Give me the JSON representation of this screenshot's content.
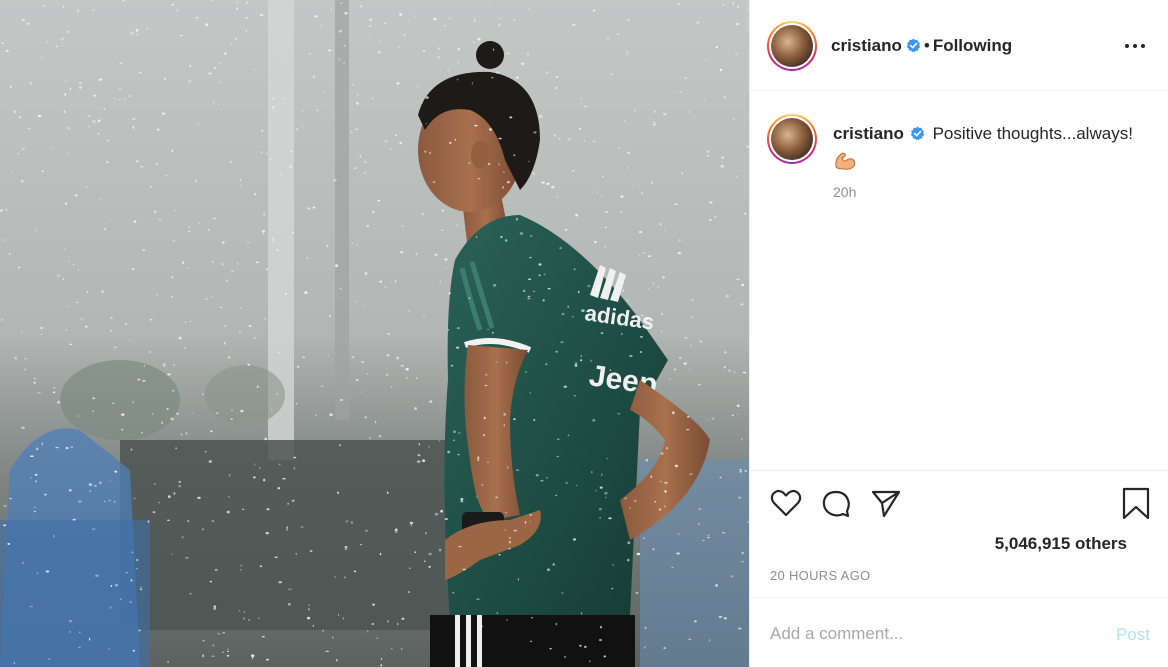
{
  "post": {
    "username": "cristiano",
    "follow_separator": "•",
    "follow_state": "Following",
    "caption": "Positive thoughts...always!",
    "caption_emoji": "flexed-biceps",
    "relative_time": "20h",
    "likes_text": "5,046,915 others",
    "posted_time": "20 HOURS AGO"
  },
  "comment": {
    "placeholder": "Add a comment...",
    "post_label": "Post"
  },
  "photo": {
    "jersey_brand": "adidas",
    "jersey_sponsor": "Jeep"
  },
  "icons": {
    "more": "more-options-icon",
    "verified": "verified-badge-icon",
    "like": "heart-icon",
    "comment": "comment-bubble-icon",
    "share": "paper-plane-icon",
    "save": "bookmark-icon"
  },
  "colors": {
    "verified": "#3897f0",
    "muted": "#8e8e8e",
    "post_disabled": "#b2dffc",
    "jersey": "#1f4e45"
  }
}
